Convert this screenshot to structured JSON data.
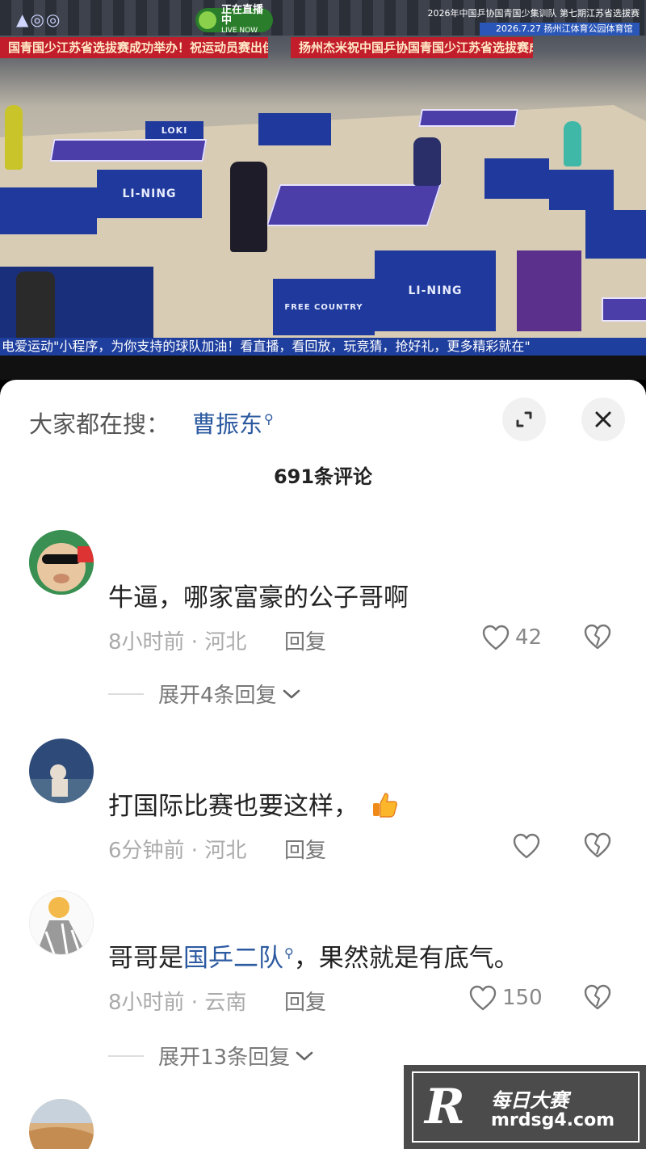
{
  "video": {
    "banner_left": "国青国少江苏省选拔赛成功举办！祝运动员赛出佳绩！",
    "banner_right": "扬州杰米祝中国乒协国青国少江苏省选拔赛成功举办",
    "live_label": "正在直播中",
    "live_sub": "LIVE NOW",
    "event_title": "2026年中国乒协国青国少集训队  第七期江苏省选拔赛",
    "event_date": "2026.7.27  扬州江体育公园体育馆",
    "fence_brand": "LI-NING",
    "fence_brand_2": "LOKI",
    "fence_brand_3": "FREE COUNTRY",
    "ticker": "电爱运动\"小程序，为你支持的球队加油！看直播，看回放，玩竞猜，抢好礼，更多精彩就在\""
  },
  "sheet": {
    "search_prefix": "大家都在搜：",
    "search_term": "曹振东",
    "comment_count": "691条评论",
    "icons": {
      "expand": "expand-icon",
      "close": "close-icon",
      "like": "heart-icon",
      "dislike": "broken-heart-icon"
    }
  },
  "comments": [
    {
      "text": "牛逼，哪家富豪的公子哥啊",
      "time": "8小时前",
      "location": "河北",
      "reply_label": "回复",
      "likes": "42",
      "expand_label": "展开4条回复"
    },
    {
      "text": "打国际比赛也要这样，",
      "time": "6分钟前",
      "location": "河北",
      "reply_label": "回复",
      "likes": ""
    },
    {
      "text_before": "哥哥是",
      "text_link": "国乒二队",
      "text_after": "，果然就是有底气。",
      "time": "8小时前",
      "location": "云南",
      "reply_label": "回复",
      "likes": "150",
      "expand_label": "展开13条回复"
    }
  ],
  "watermark": {
    "logo": "R",
    "name": "每日大赛",
    "url": "mrdsg4.com"
  }
}
